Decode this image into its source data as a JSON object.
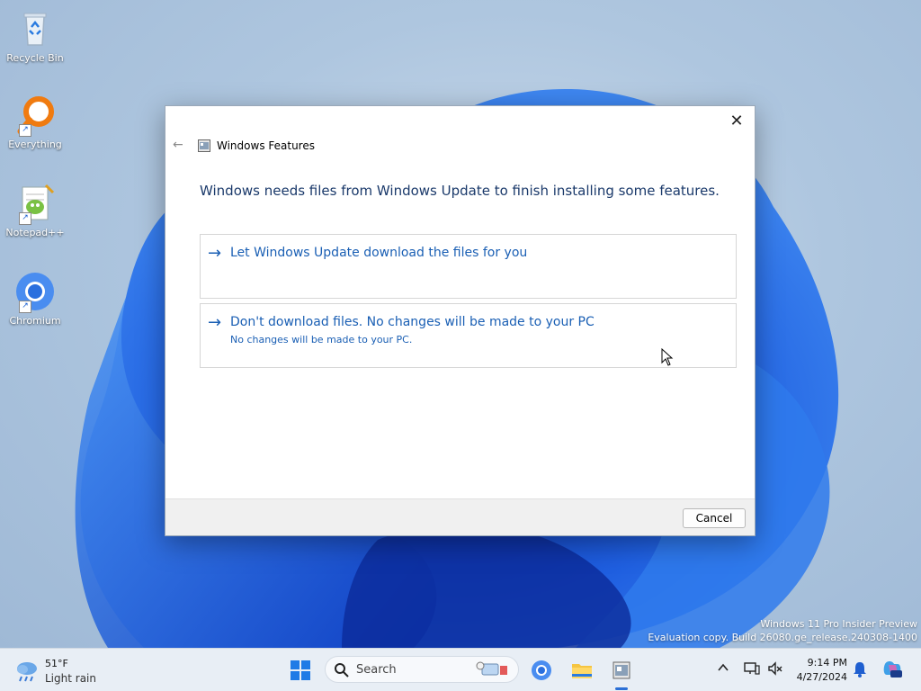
{
  "desktop": {
    "icons": [
      {
        "label": "Recycle Bin"
      },
      {
        "label": "Everything"
      },
      {
        "label": "Notepad++"
      },
      {
        "label": "Chromium"
      }
    ],
    "watermark": {
      "line1": "Windows 11 Pro Insider Preview",
      "line2": "Evaluation copy. Build 26080.ge_release.240308-1400"
    }
  },
  "dialog": {
    "title": "Windows Features",
    "heading": "Windows needs files from Windows Update to finish installing some features.",
    "options": [
      {
        "main": "Let Windows Update download the files for you",
        "sub": ""
      },
      {
        "main": "Don't download files. No changes will be made to your PC",
        "sub": "No changes will be made to your PC."
      }
    ],
    "cancel_label": "Cancel",
    "close_glyph": "✕",
    "back_glyph": "←",
    "arrow_glyph": "→"
  },
  "taskbar": {
    "weather": {
      "temp": "51°F",
      "condition": "Light rain"
    },
    "search": {
      "placeholder": "Search"
    },
    "pinned": [
      "start-icon",
      "chromium-icon",
      "file-explorer-icon",
      "windows-features-icon"
    ],
    "tray": {
      "chevron": "^"
    },
    "clock": {
      "time": "9:14 PM",
      "date": "4/27/2024"
    }
  },
  "colors": {
    "accent": "#1a5fb4",
    "heading": "#1b3a6b",
    "taskbar": "#e8eef5"
  }
}
